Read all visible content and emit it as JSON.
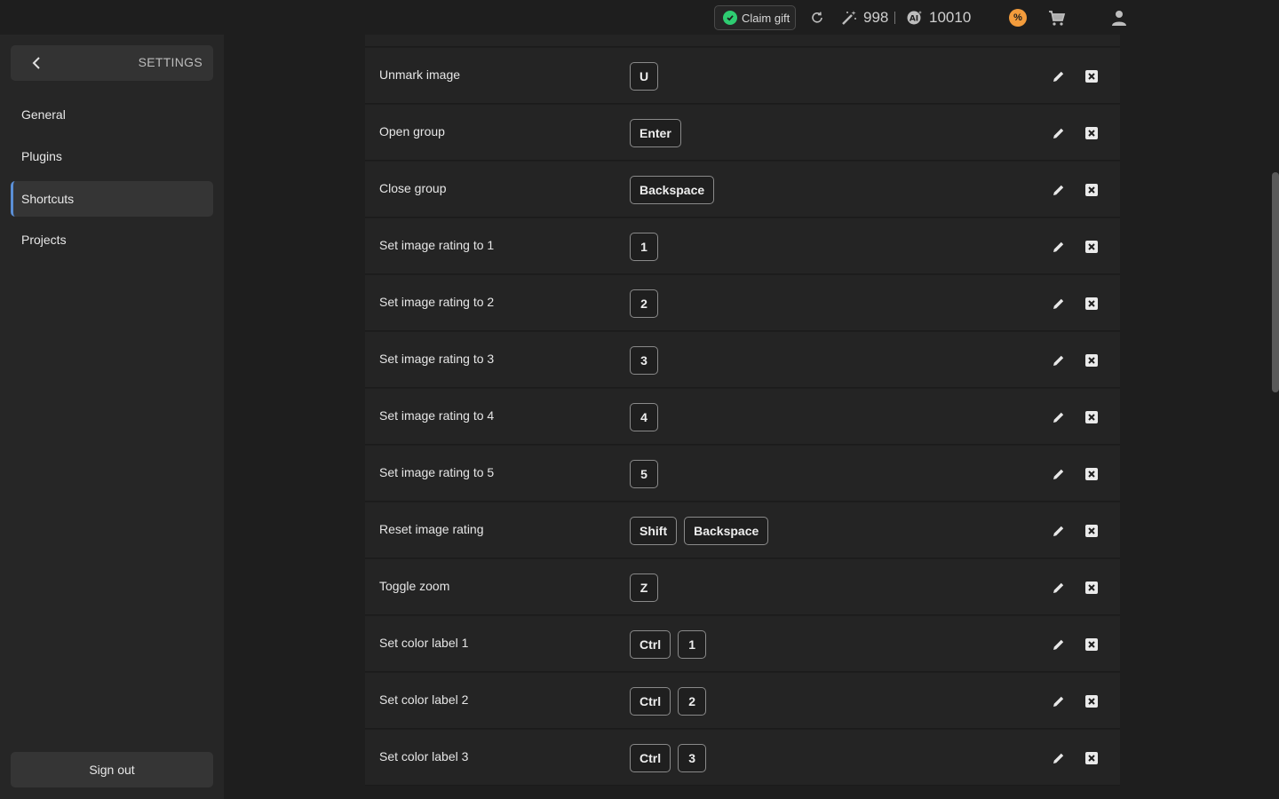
{
  "topbar": {
    "claim_gift_label": "Claim gift",
    "magic_credits": "998",
    "ai_credits": "10010",
    "icons": [
      "check-circle-icon",
      "refresh-icon",
      "magic-wand-icon",
      "ai-credit-icon",
      "promo-icon",
      "cart-icon",
      "user-icon"
    ],
    "accent_green": "#2ecc71",
    "accent_orange": "#f39c3c"
  },
  "sidebar": {
    "back_label": "SETTINGS",
    "items": [
      {
        "label": "General",
        "active": false
      },
      {
        "label": "Plugins",
        "active": false
      },
      {
        "label": "Shortcuts",
        "active": true
      },
      {
        "label": "Projects",
        "active": false
      }
    ],
    "signout_label": "Sign out",
    "active_accent": "#5b8fd6"
  },
  "shortcuts": [
    {
      "label": "Unmark image",
      "keys": [
        "U"
      ]
    },
    {
      "label": "Open group",
      "keys": [
        "Enter"
      ]
    },
    {
      "label": "Close group",
      "keys": [
        "Backspace"
      ]
    },
    {
      "label": "Set image rating to 1",
      "keys": [
        "1"
      ]
    },
    {
      "label": "Set image rating to 2",
      "keys": [
        "2"
      ]
    },
    {
      "label": "Set image rating to 3",
      "keys": [
        "3"
      ]
    },
    {
      "label": "Set image rating to 4",
      "keys": [
        "4"
      ]
    },
    {
      "label": "Set image rating to 5",
      "keys": [
        "5"
      ]
    },
    {
      "label": "Reset image rating",
      "keys": [
        "Shift",
        "Backspace"
      ]
    },
    {
      "label": "Toggle zoom",
      "keys": [
        "Z"
      ]
    },
    {
      "label": "Set color label 1",
      "keys": [
        "Ctrl",
        "1"
      ]
    },
    {
      "label": "Set color label 2",
      "keys": [
        "Ctrl",
        "2"
      ]
    },
    {
      "label": "Set color label 3",
      "keys": [
        "Ctrl",
        "3"
      ]
    }
  ]
}
